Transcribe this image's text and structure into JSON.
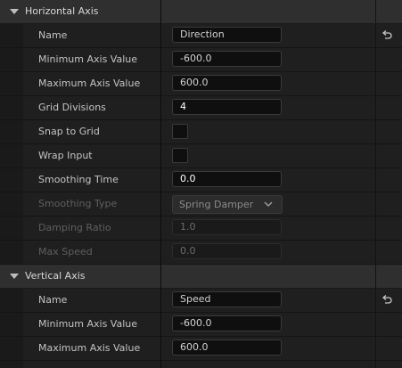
{
  "horizontal_axis": {
    "title": "Horizontal Axis",
    "rows": [
      {
        "label": "Name",
        "value": "Direction"
      },
      {
        "label": "Minimum Axis Value",
        "value": "-600.0"
      },
      {
        "label": "Maximum Axis Value",
        "value": "600.0"
      },
      {
        "label": "Grid Divisions",
        "value": "4"
      },
      {
        "label": "Snap to Grid",
        "checked": false
      },
      {
        "label": "Wrap Input",
        "checked": false
      },
      {
        "label": "Smoothing Time",
        "value": "0.0"
      },
      {
        "label": "Smoothing Type",
        "value": "Spring Damper"
      },
      {
        "label": "Damping Ratio",
        "value": "1.0"
      },
      {
        "label": "Max Speed",
        "value": "0.0"
      }
    ]
  },
  "vertical_axis": {
    "title": "Vertical Axis",
    "rows": [
      {
        "label": "Name",
        "value": "Speed"
      },
      {
        "label": "Minimum Axis Value",
        "value": "-600.0"
      },
      {
        "label": "Maximum Axis Value",
        "value": "600.0"
      }
    ]
  },
  "icons": {
    "reset": "reset-arrow-icon",
    "expand": "triangle-down-icon",
    "dropdown": "chevron-down-icon"
  }
}
